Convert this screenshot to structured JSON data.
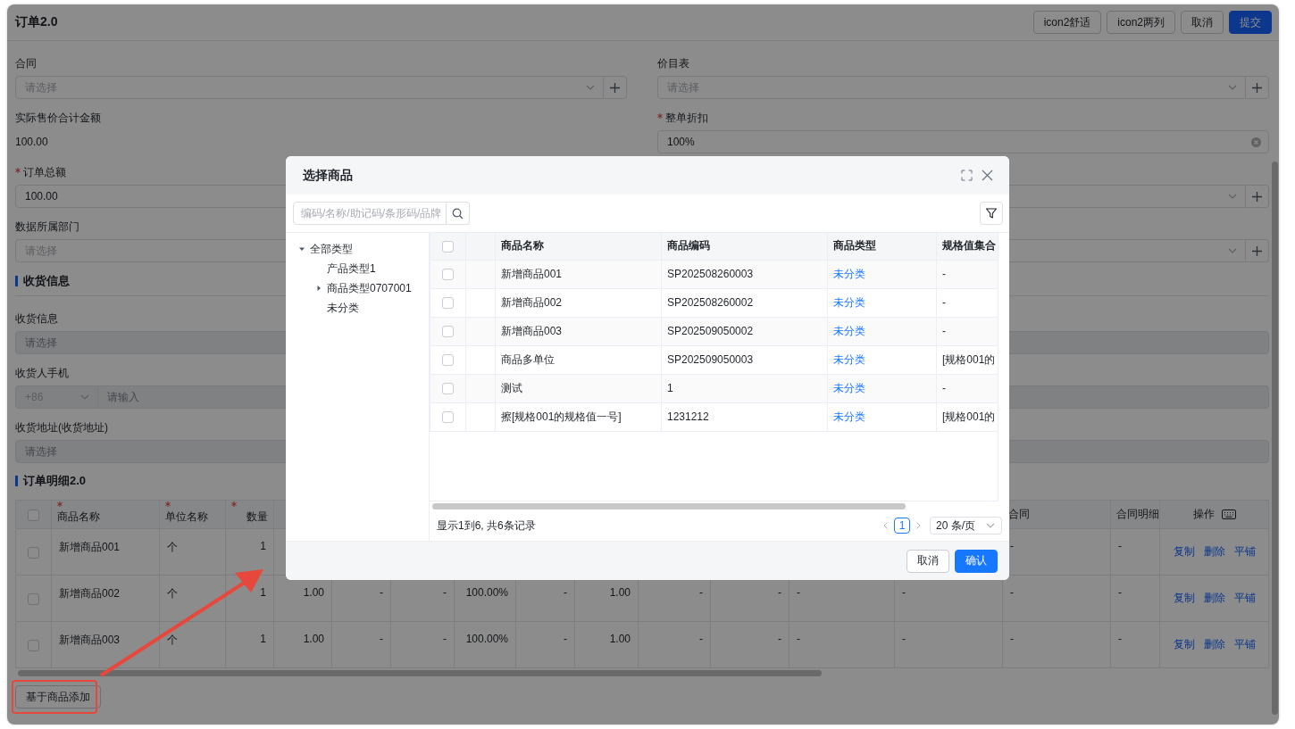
{
  "window": {
    "title": "订单2.0",
    "buttons": [
      {
        "label": "icon2舒适",
        "kind": "default"
      },
      {
        "label": "icon2两列",
        "kind": "default"
      },
      {
        "label": "取消",
        "kind": "default"
      },
      {
        "label": "提交",
        "kind": "primary"
      }
    ]
  },
  "form": {
    "fields": [
      {
        "label": "合同",
        "kind": "select",
        "placeholder": "请选择",
        "addable": true
      },
      {
        "label": "价目表",
        "kind": "select",
        "placeholder": "请选择",
        "addable": true
      },
      {
        "label": "实际售价合计金额",
        "kind": "text",
        "value": "100.00"
      },
      {
        "label": "整单折扣",
        "required": true,
        "kind": "input",
        "value": "100%",
        "clearable": true
      },
      {
        "label": "订单总额",
        "required": true,
        "kind": "input",
        "value": "100.00"
      },
      {
        "kind": "select",
        "addable": true
      },
      {
        "label": "数据所属部门",
        "kind": "select",
        "placeholder": "请选择"
      },
      {
        "kind": "select",
        "addable": true
      }
    ]
  },
  "shipping": {
    "title": "收货信息",
    "fields": [
      {
        "label": "收货信息",
        "kind": "select",
        "placeholder": "请选择",
        "disabled": true
      },
      {
        "label": "收货人手机",
        "kind": "phone",
        "prefix": "+86",
        "placeholder": "请输入",
        "disabled": true
      },
      {
        "label": "收货地址(收货地址)",
        "kind": "select",
        "placeholder": "请选择",
        "disabled": true
      }
    ]
  },
  "details": {
    "title": "订单明细2.0",
    "header_checked": false,
    "columns": [
      {
        "label": "商品名称",
        "required": true,
        "kind": "text"
      },
      {
        "label": "单位名称",
        "required": true,
        "kind": "text"
      },
      {
        "label": "数量",
        "required": true,
        "kind": "number"
      },
      {
        "kind": "number"
      },
      {
        "kind": "number"
      },
      {
        "kind": "number"
      },
      {
        "kind": "number"
      },
      {
        "kind": "number"
      },
      {
        "kind": "number"
      },
      {
        "kind": "number"
      },
      {
        "kind": "number"
      },
      {
        "kind": "text"
      },
      {
        "kind": "text"
      },
      {
        "label": "合同",
        "kind": "text"
      },
      {
        "label": "合同明细",
        "kind": "text"
      }
    ],
    "actions_label": "操作",
    "rows": [
      {
        "checked": false,
        "cells": [
          "新增商品001",
          "个",
          "1",
          null,
          null,
          null,
          null,
          null,
          null,
          null,
          null,
          null,
          null,
          "-",
          "-"
        ],
        "actions": [
          "复制",
          "删除",
          "平铺"
        ]
      },
      {
        "checked": false,
        "cells": [
          "新增商品002",
          "个",
          "1",
          "1.00",
          "-",
          "-",
          "100.00%",
          "-",
          "1.00",
          "-",
          "-",
          "-",
          "-",
          "-",
          "-"
        ],
        "actions": [
          "复制",
          "删除",
          "平铺"
        ]
      },
      {
        "checked": false,
        "cells": [
          "新增商品003",
          "个",
          "1",
          "1.00",
          "-",
          "-",
          "100.00%",
          "-",
          "1.00",
          "-",
          "-",
          "-",
          "-",
          "-",
          "-"
        ],
        "actions": [
          "复制",
          "删除",
          "平铺"
        ]
      }
    ],
    "add_button": "基于商品添加"
  },
  "dialog": {
    "title": "选择商品",
    "search": {
      "placeholder": "编码/名称/助记码/条形码/品牌"
    },
    "tree": [
      {
        "label": "全部类型",
        "expanded": true,
        "children": [
          {
            "label": "产品类型1"
          },
          {
            "label": "商品类型0707001",
            "expanded": false
          },
          {
            "label": "未分类"
          }
        ]
      }
    ],
    "table": {
      "header_checked": false,
      "columns": [
        "商品名称",
        "商品编码",
        "商品类型",
        "规格值集合"
      ],
      "rows": [
        {
          "checked": false,
          "name": "新增商品001",
          "code": "SP202508260003",
          "type": "未分类",
          "specs": "-"
        },
        {
          "checked": false,
          "name": "新增商品002",
          "code": "SP202508260002",
          "type": "未分类",
          "specs": "-"
        },
        {
          "checked": false,
          "name": "新增商品003",
          "code": "SP202509050002",
          "type": "未分类",
          "specs": "-"
        },
        {
          "checked": false,
          "name": "商品多单位",
          "code": "SP202509050003",
          "type": "未分类",
          "specs": "[规格001的"
        },
        {
          "checked": false,
          "name": "测试",
          "code": "1",
          "type": "未分类",
          "specs": "-"
        },
        {
          "checked": false,
          "name": "擦[规格001的规格值一号]",
          "code": "1231212",
          "type": "未分类",
          "specs": "[规格001的"
        }
      ]
    },
    "summary": "显示1到6, 共6条记录",
    "pagination": {
      "pages": [
        {
          "label": "1",
          "selected": true
        }
      ],
      "page_size": "20 条/页"
    },
    "buttons": [
      {
        "label": "取消",
        "kind": "default"
      },
      {
        "label": "确认",
        "kind": "primary"
      }
    ]
  }
}
